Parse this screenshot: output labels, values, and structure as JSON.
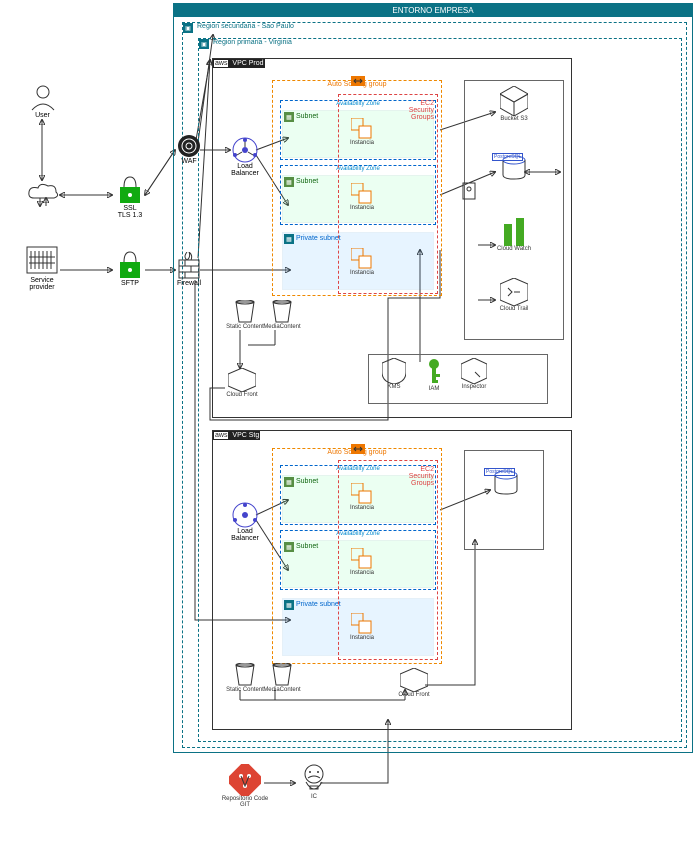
{
  "title": "ENTORNO EMPRESA",
  "regions": {
    "secondary": "Region secundaria - Sao Paulo",
    "primary": "   Region primaria - Virginia"
  },
  "left": {
    "user": "User",
    "serviceProvider": "Service provider",
    "ssl": "SSL\nTLS 1.3",
    "sftp": "SFTP",
    "waf": "WAF",
    "firewall": "Firewall"
  },
  "vpcProd": {
    "title": "   VPC Prod",
    "asg": "Auto Scaling group",
    "az": "Availability Zone",
    "subnet": "Subnet",
    "privateSubnet": "Private subnet",
    "instancia": "Instancia",
    "ec2": "EC2\nSecurity\nGroups",
    "lb": "Load Balancer",
    "staticContent": "Static Content",
    "mediaContent": "MediaContent",
    "cloudFront": "Cloud Front",
    "bucket": "Bucket S3",
    "postgres": "PostgreSQL",
    "cloudWatch": "Cloud Watch",
    "cloudTrail": "Cloud Trail",
    "kms": "KMS",
    "iam": "IAM",
    "inspector": "Inspector"
  },
  "vpcStg": {
    "title": "   VPC Stg",
    "cloudFront": "Cloud Front"
  },
  "bottom": {
    "git": "Repositorio Code GIT",
    "ic": "IC"
  }
}
